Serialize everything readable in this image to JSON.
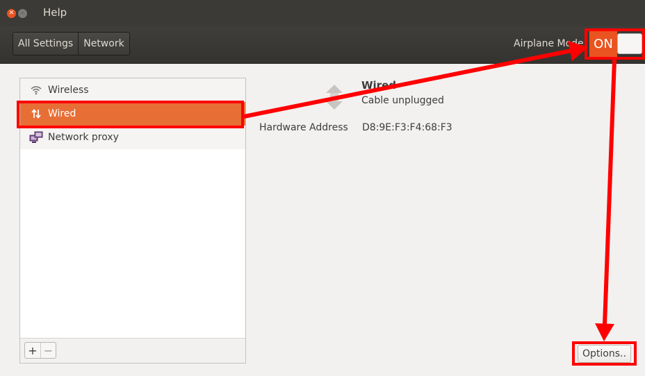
{
  "window": {
    "title": "Help"
  },
  "toolbar": {
    "breadcrumbs": [
      "All Settings",
      "Network"
    ],
    "airplane_mode_label": "Airplane Mode",
    "airplane_switch_state": "ON"
  },
  "sidebar": {
    "items": [
      {
        "label": "Wireless",
        "icon": "wifi-icon"
      },
      {
        "label": "Wired",
        "icon": "wired-arrows-icon",
        "selected": true
      },
      {
        "label": "Network proxy",
        "icon": "network-proxy-icon"
      }
    ],
    "add_label": "+",
    "remove_label": "−"
  },
  "detail": {
    "title": "Wired",
    "status": "Cable unplugged",
    "hardware_address_label": "Hardware Address",
    "hardware_address_value": "D8:9E:F3:F4:68:F3",
    "options_label": "Options.."
  },
  "colors": {
    "accent": "#e95420",
    "selection": "#e76f36",
    "annotation": "#ff0000",
    "titlebar": "#3b3a36"
  }
}
